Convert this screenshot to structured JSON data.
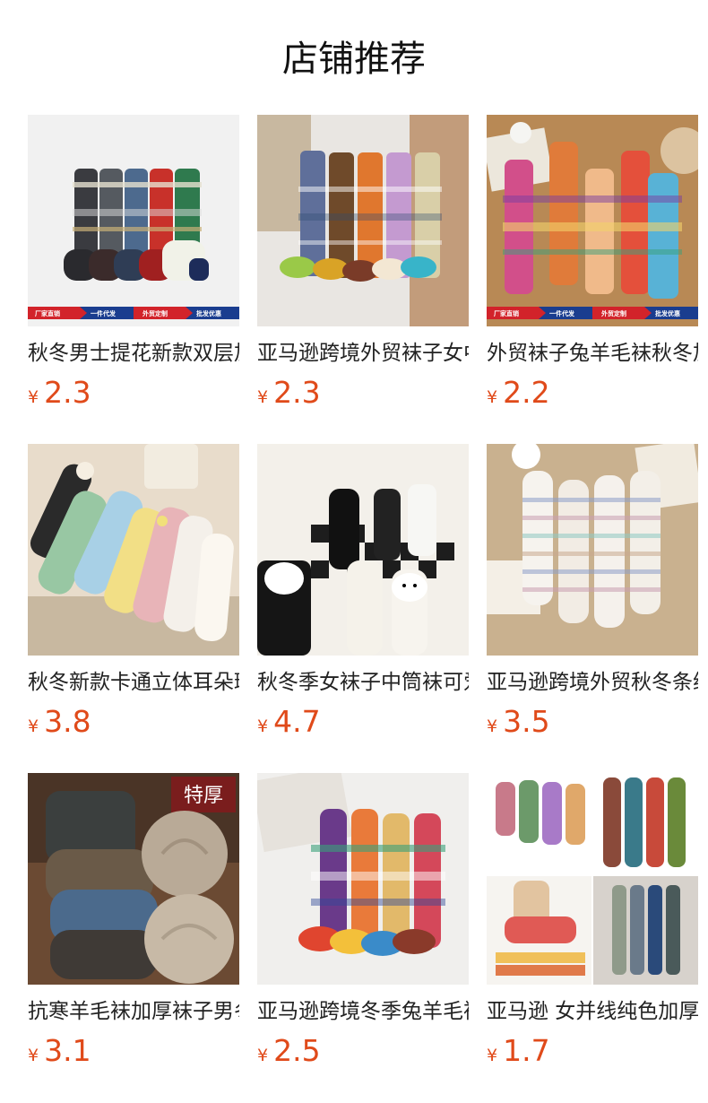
{
  "header": {
    "title": "店铺推荐"
  },
  "currency_symbol": "¥",
  "products": [
    {
      "name": "秋冬男士提花新款双层加厚袜子",
      "price": "2.3",
      "banner": [
        "厂家直销",
        "一件代发",
        "外贸定制",
        "批发优惠"
      ],
      "icon": "nordic-socks-image"
    },
    {
      "name": "亚马逊跨境外贸袜子女中筒袜",
      "price": "2.3",
      "icon": "colorful-wool-socks-image"
    },
    {
      "name": "外贸袜子兔羊毛袜秋冬加厚",
      "price": "2.2",
      "banner": [
        "厂家直销",
        "一件代发",
        "外贸定制",
        "批发优惠"
      ],
      "icon": "pattern-wool-socks-image"
    },
    {
      "name": "秋冬新款卡通立体耳朵珊瑚绒袜",
      "price": "3.8",
      "icon": "cartoon-ear-socks-image"
    },
    {
      "name": "秋冬季女袜子中筒袜可爱卡通",
      "price": "4.7",
      "icon": "black-white-plush-socks-image"
    },
    {
      "name": "亚马逊跨境外贸秋冬条纹毛绒袜",
      "price": "3.5",
      "icon": "striped-fleece-socks-image"
    },
    {
      "name": "抗寒羊毛袜加厚袜子男冬季",
      "price": "3.1",
      "tag": "特厚",
      "icon": "thick-wool-socks-image"
    },
    {
      "name": "亚马逊跨境冬季兔羊毛袜子",
      "price": "2.5",
      "icon": "ethnic-pattern-socks-image"
    },
    {
      "name": "亚马逊 女并线纯色加厚羊毛袜",
      "price": "1.7",
      "icon": "solid-color-wool-socks-image"
    }
  ]
}
